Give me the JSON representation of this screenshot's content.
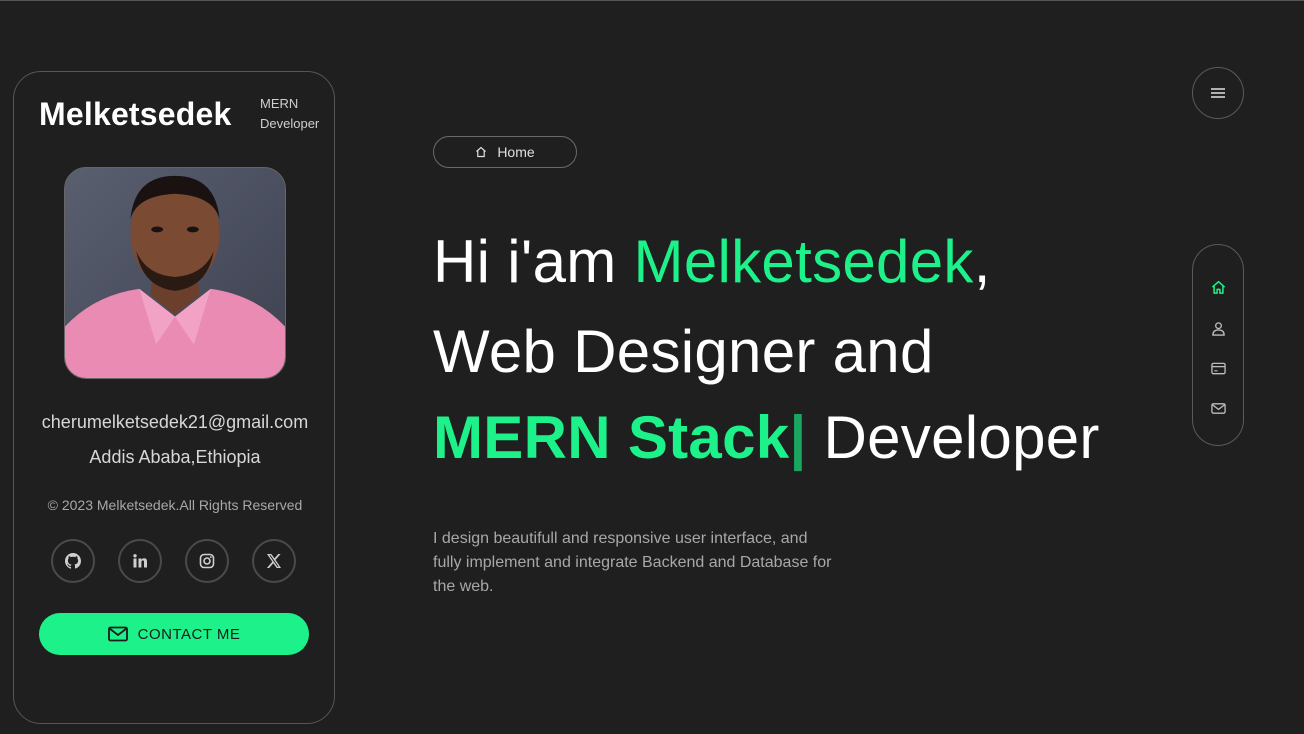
{
  "profile": {
    "name": "Melketsedek",
    "role_line1": "MERN",
    "role_line2": "Developer",
    "email": "cherumelketsedek21@gmail.com",
    "location": "Addis Ababa,Ethiopia",
    "copyright": "© 2023 Melketsedek.All Rights Reserved",
    "socials": [
      "github-icon",
      "linkedin-icon",
      "instagram-icon",
      "x-icon"
    ],
    "contact_label": "CONTACT ME"
  },
  "hero": {
    "badge_label": "Home",
    "greeting": "Hi i'am ",
    "name": "Melketsedek",
    "comma": ",",
    "line2": "Web Designer and",
    "stack": "MERN Stack",
    "cursor": "|",
    "role": " Developer",
    "description": "I design beautifull and responsive user interface, and fully implement and integrate Backend and Database for the web."
  },
  "side_nav": {
    "menu_icon": "hamburger-icon",
    "items": [
      "home-icon",
      "user-icon",
      "card-icon",
      "mail-icon"
    ]
  },
  "colors": {
    "accent": "#1df28a",
    "background": "#1f1f1f",
    "border": "#565656"
  }
}
